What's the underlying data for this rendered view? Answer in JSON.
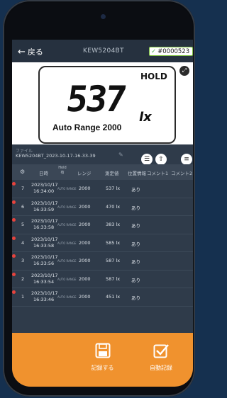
{
  "header": {
    "back_label": "戻る",
    "title": "KEW5204BT",
    "device_id": "#0000523"
  },
  "display": {
    "hold": "HOLD",
    "reading": "537",
    "unit": "lx",
    "range": "Auto Range 2000"
  },
  "file": {
    "label": "ファイル",
    "name": "KEW5204BT_2023-10-17-16-33-39"
  },
  "table": {
    "headers": [
      "日時",
      "Hold 有",
      "レンジ",
      "測定値",
      "位置情報",
      "コメント1",
      "コメント2"
    ],
    "rows": [
      {
        "no": "7",
        "date": "2023/10/17",
        "time": "16:34:00",
        "mode": "AUTO RANGE",
        "range": "2000",
        "value": "537 lx",
        "loc": "あり"
      },
      {
        "no": "6",
        "date": "2023/10/17",
        "time": "16:33:59",
        "mode": "AUTO RANGE",
        "range": "2000",
        "value": "470 lx",
        "loc": "あり"
      },
      {
        "no": "5",
        "date": "2023/10/17",
        "time": "16:33:58",
        "mode": "AUTO RANGE",
        "range": "2000",
        "value": "383 lx",
        "loc": "あり"
      },
      {
        "no": "4",
        "date": "2023/10/17",
        "time": "16:33:58",
        "mode": "AUTO RANGE",
        "range": "2000",
        "value": "585 lx",
        "loc": "あり"
      },
      {
        "no": "3",
        "date": "2023/10/17",
        "time": "16:33:56",
        "mode": "AUTO RANGE",
        "range": "2000",
        "value": "587 lx",
        "loc": "あり"
      },
      {
        "no": "2",
        "date": "2023/10/17",
        "time": "16:33:54",
        "mode": "AUTO RANGE",
        "range": "2000",
        "value": "587 lx",
        "loc": "あり"
      },
      {
        "no": "1",
        "date": "2023/10/17",
        "time": "16:33:46",
        "mode": "AUTO RANGE",
        "range": "2000",
        "value": "451 lx",
        "loc": "あり"
      }
    ]
  },
  "footer": {
    "record_label": "記録する",
    "auto_label": "自動記録"
  },
  "colors": {
    "accent": "#f0922e",
    "marker": "#e8423c",
    "check": "#7fc241"
  }
}
